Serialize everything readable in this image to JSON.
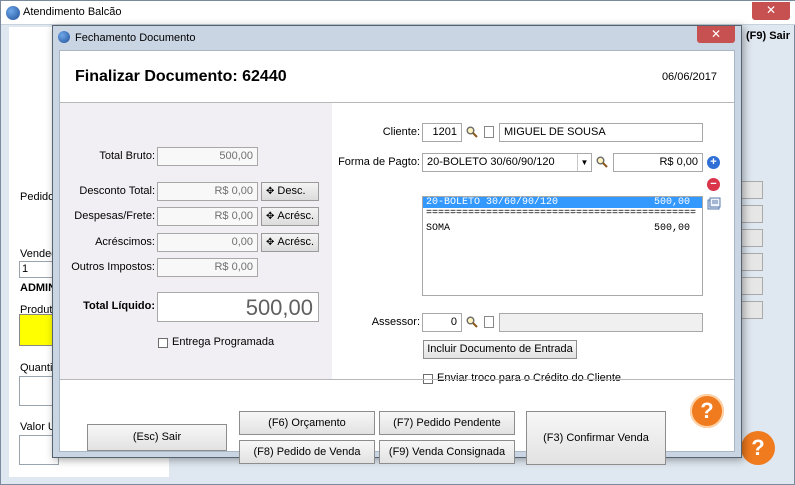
{
  "bg_window": {
    "title": "Atendimento Balcão",
    "close_glyph": "✕",
    "sair_label": "(F9) Sair",
    "left_labels": [
      "Pedido",
      "Vended",
      "1",
      "ADMIN",
      "Produto",
      "Quantid",
      "Valor U"
    ],
    "help_glyph": "?"
  },
  "dialog": {
    "title": "Fechamento Documento",
    "close_glyph": "✕",
    "header": {
      "title": "Finalizar Documento: 62440",
      "date": "06/06/2017"
    },
    "totals": {
      "total_bruto_label": "Total Bruto:",
      "total_bruto_value": "500,00",
      "desconto_label": "Desconto Total:",
      "desconto_value": "R$ 0,00",
      "desconto_btn": "Desc.",
      "despesas_label": "Despesas/Frete:",
      "despesas_value": "R$ 0,00",
      "despesas_btn": "Acrésc.",
      "acrescimos_label": "Acréscimos:",
      "acrescimos_value": "0,00",
      "acrescimos_btn": "Acrésc.",
      "outros_label": "Outros Impostos:",
      "outros_value": "R$ 0,00",
      "liquido_label": "Total Líquido:",
      "liquido_value": "500,00",
      "entrega_label": "Entrega Programada",
      "entrega_checked": false
    },
    "cliente": {
      "label": "Cliente:",
      "code": "1201",
      "name": "MIGUEL DE SOUSA"
    },
    "pagamento": {
      "label": "Forma de Pagto:",
      "selected": "20-BOLETO 30/60/90/120",
      "value": "R$ 0,00",
      "list": [
        {
          "text": "20-BOLETO 30/60/90/120",
          "amount": "500,00",
          "selected": true
        },
        {
          "text": "=============================================",
          "amount": "",
          "selected": false
        },
        {
          "text": "SOMA",
          "amount": "500,00",
          "selected": false
        }
      ]
    },
    "assessor": {
      "label": "Assessor:",
      "code": "0",
      "name": ""
    },
    "incluir_btn": "Incluir Documento de Entrada",
    "troco_label": "Enviar troco para o Crédito do Cliente",
    "troco_checked": false,
    "footer": {
      "sair": "(Esc) Sair",
      "orcamento": "(F6) Orçamento",
      "pedido_venda": "(F8) Pedido de Venda",
      "pedido_pendente": "(F7) Pedido Pendente",
      "venda_consignada": "(F9) Venda Consignada",
      "confirmar": "(F3) Confirmar Venda",
      "help_glyph": "?"
    },
    "colors": {
      "selection": "#3399ff",
      "help": "#f07a1e",
      "close": "#c75050",
      "add_icon": "#2f6fd6",
      "remove_icon": "#d9344a"
    }
  }
}
